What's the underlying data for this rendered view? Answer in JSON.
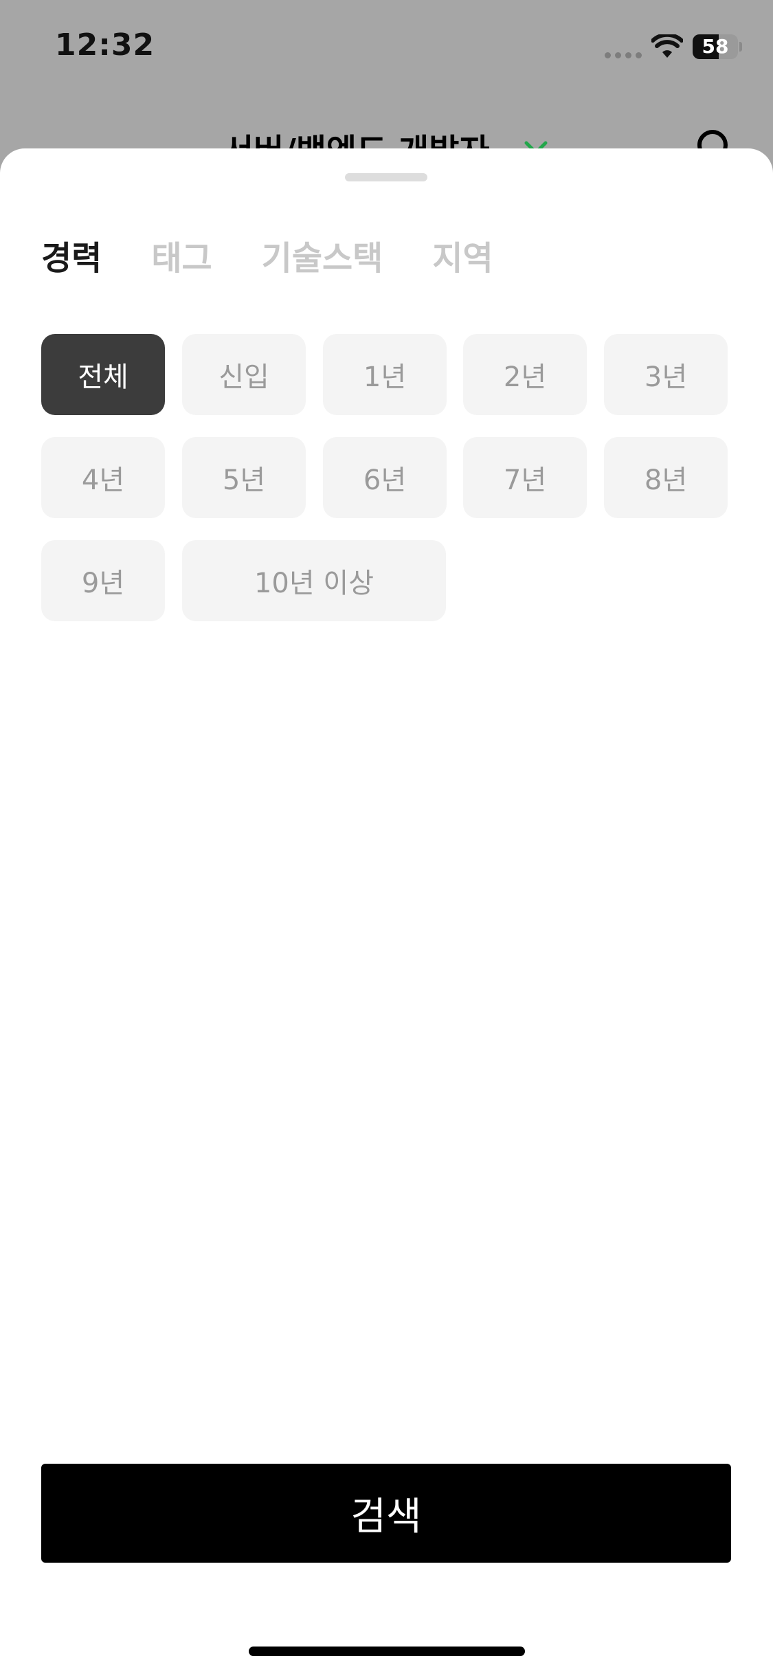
{
  "status_bar": {
    "time": "12:32",
    "battery_level": "58",
    "battery_percent": 58,
    "icons": [
      "cellular-signal-icon",
      "wifi-icon",
      "battery-icon"
    ]
  },
  "header": {
    "title": "서버/백엔드 개발자",
    "accent_color": "#22a64a",
    "icons": [
      "chevron-down-icon",
      "search-icon"
    ]
  },
  "sheet": {
    "tabs": [
      {
        "label": "경력",
        "active": true
      },
      {
        "label": "태그",
        "active": false
      },
      {
        "label": "기술스택",
        "active": false
      },
      {
        "label": "지역",
        "active": false
      }
    ],
    "options": [
      {
        "label": "전체",
        "selected": true
      },
      {
        "label": "신입",
        "selected": false
      },
      {
        "label": "1년",
        "selected": false
      },
      {
        "label": "2년",
        "selected": false
      },
      {
        "label": "3년",
        "selected": false
      },
      {
        "label": "4년",
        "selected": false
      },
      {
        "label": "5년",
        "selected": false
      },
      {
        "label": "6년",
        "selected": false
      },
      {
        "label": "7년",
        "selected": false
      },
      {
        "label": "8년",
        "selected": false
      },
      {
        "label": "9년",
        "selected": false
      },
      {
        "label": "10년 이상",
        "selected": false
      }
    ],
    "search_label": "검색"
  },
  "colors": {
    "dim_background": "#a6a6a6",
    "selected_chip": "#3c3c3c",
    "chip_background": "#f4f4f4",
    "button_background": "#000000"
  }
}
